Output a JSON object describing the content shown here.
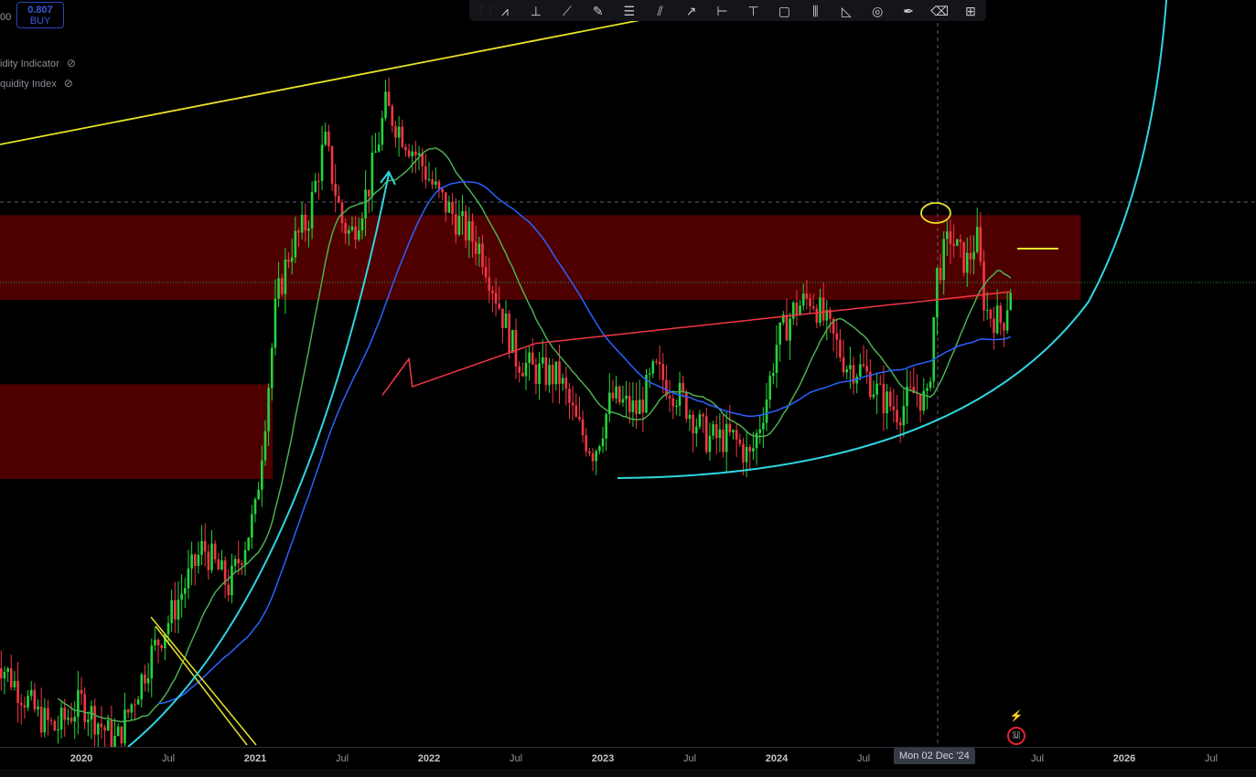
{
  "legend": {
    "price_partial": "00",
    "signal_value": "0.807",
    "signal_label": "BUY",
    "indicators": [
      {
        "label": "idity Indicator",
        "icon": "eye-off-icon"
      },
      {
        "label": "quidity Index",
        "icon": "eye-off-icon"
      }
    ]
  },
  "toolbar": {
    "tools": [
      "pattern",
      "fib-trend",
      "trend-line",
      "brush",
      "parallel-channel",
      "ray",
      "arrow",
      "date-range",
      "price-range",
      "rectangle",
      "long-position",
      "triangle",
      "circle",
      "pen",
      "eraser",
      "measure"
    ]
  },
  "crosshair": {
    "date_label": "Mon 02 Dec '24"
  },
  "colors": {
    "up": "#22d43a",
    "down": "#f23645",
    "ma_fast": "#4caf50",
    "ma_mid": "#2962ff",
    "ma_slow": "#f23645",
    "zone": "#5c0000",
    "cyan": "#30d5e0",
    "yellow": "#e8e32a"
  },
  "chart_data": {
    "type": "candlestick",
    "title": "",
    "xlabel": "",
    "ylabel": "",
    "x_ticks": [
      "2020",
      "Jul",
      "2021",
      "Jul",
      "2022",
      "Jul",
      "2023",
      "Jul",
      "2024",
      "Jul",
      "Jul",
      "2026",
      "Jul"
    ],
    "x_tick_years": [
      2020,
      2020.5,
      2021,
      2021.5,
      2022,
      2022.5,
      2023,
      2023.5,
      2024,
      2024.5,
      2025.5,
      2026,
      2026.5
    ],
    "xlim": [
      2019.53,
      2026.75
    ],
    "ylim": [
      0,
      100
    ],
    "price_path": [
      [
        2019.5,
        14
      ],
      [
        2019.75,
        5
      ],
      [
        2019.85,
        3
      ],
      [
        2020,
        7
      ],
      [
        2020.2,
        1
      ],
      [
        2020.4,
        14
      ],
      [
        2020.5,
        19
      ],
      [
        2020.7,
        30
      ],
      [
        2020.85,
        24
      ],
      [
        2021,
        35
      ],
      [
        2021.08,
        55
      ],
      [
        2021.12,
        66
      ],
      [
        2021.2,
        74
      ],
      [
        2021.3,
        78
      ],
      [
        2021.4,
        90
      ],
      [
        2021.5,
        78
      ],
      [
        2021.55,
        76
      ],
      [
        2021.65,
        83
      ],
      [
        2021.75,
        95
      ],
      [
        2021.85,
        91
      ],
      [
        2021.95,
        87
      ],
      [
        2022.05,
        82
      ],
      [
        2022.2,
        77
      ],
      [
        2022.3,
        74
      ],
      [
        2022.4,
        66
      ],
      [
        2022.5,
        58
      ],
      [
        2022.6,
        56
      ],
      [
        2022.75,
        55
      ],
      [
        2022.85,
        48
      ],
      [
        2022.95,
        44
      ],
      [
        2023.05,
        52
      ],
      [
        2023.2,
        50
      ],
      [
        2023.3,
        56
      ],
      [
        2023.45,
        52
      ],
      [
        2023.6,
        46
      ],
      [
        2023.75,
        46
      ],
      [
        2023.85,
        43
      ],
      [
        2023.95,
        53
      ],
      [
        2024,
        60
      ],
      [
        2024.1,
        65
      ],
      [
        2024.2,
        67
      ],
      [
        2024.3,
        62
      ],
      [
        2024.4,
        57
      ],
      [
        2024.5,
        56
      ],
      [
        2024.6,
        52
      ],
      [
        2024.7,
        50
      ],
      [
        2024.8,
        53
      ],
      [
        2024.87,
        51
      ],
      [
        2024.92,
        70
      ],
      [
        2025,
        76
      ],
      [
        2025.05,
        73
      ],
      [
        2025.1,
        72
      ],
      [
        2025.15,
        76
      ],
      [
        2025.2,
        65
      ],
      [
        2025.3,
        63
      ],
      [
        2025.35,
        69
      ]
    ],
    "moving_averages": [
      {
        "name": "MA fast",
        "period": 20
      },
      {
        "name": "MA mid",
        "period": 50
      },
      {
        "name": "MA slow",
        "period": 200
      }
    ],
    "zones": [
      {
        "from": 2019.5,
        "to": 2025.75,
        "low": 66.5,
        "high": 79
      },
      {
        "from": 2019.5,
        "to": 2021.1,
        "low": 40,
        "high": 54
      }
    ]
  }
}
